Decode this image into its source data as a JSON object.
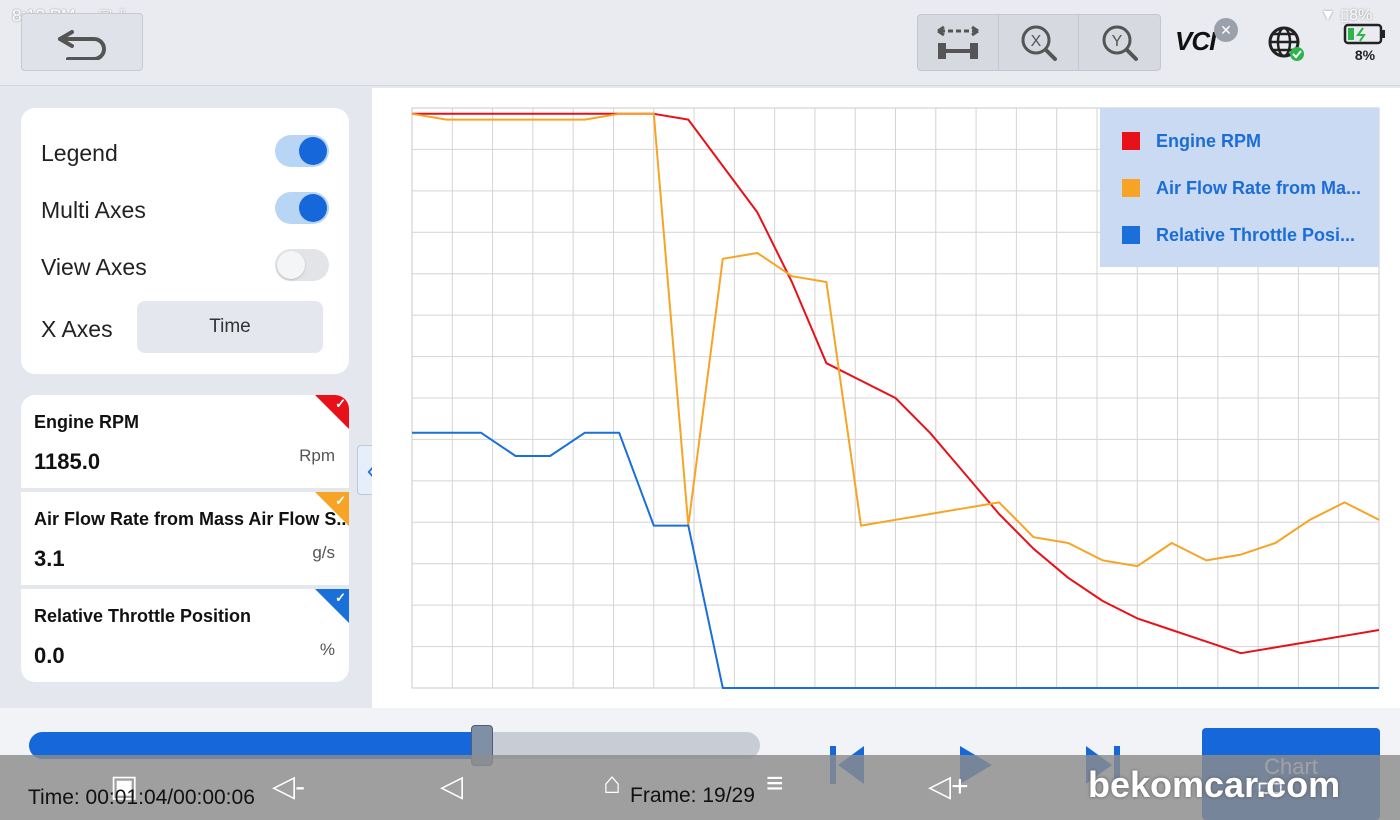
{
  "status_bar": {
    "time": "8:19 PM",
    "battery": "8%"
  },
  "topbar": {
    "back_icon": "undo-arrow-icon",
    "tools": [
      {
        "name": "fit-x-width-icon"
      },
      {
        "name": "zoom-x-icon",
        "glyph": "X"
      },
      {
        "name": "zoom-y-icon",
        "glyph": "Y"
      }
    ],
    "vci_label": "VCI",
    "battery_pct": "8%"
  },
  "settings": {
    "legend_label": "Legend",
    "legend_on": true,
    "multi_axes_label": "Multi Axes",
    "multi_axes_on": true,
    "view_axes_label": "View Axes",
    "view_axes_on": false,
    "x_axes_label": "X Axes",
    "x_axes_value": "Time"
  },
  "sensors": [
    {
      "name": "Engine RPM",
      "value": "1185.0",
      "unit": "Rpm",
      "color": "#e8111a"
    },
    {
      "name": "Air Flow Rate from Mass Air Flow S...",
      "value": "3.1",
      "unit": "g/s",
      "color": "#f7a426"
    },
    {
      "name": "Relative Throttle Position",
      "value": "0.0",
      "unit": "%",
      "color": "#1a6fd8"
    }
  ],
  "legend": [
    {
      "label": "Engine RPM",
      "color": "#e8111a"
    },
    {
      "label": "Air Flow Rate from Ma...",
      "color": "#f7a426"
    },
    {
      "label": "Relative Throttle Posi...",
      "color": "#1a6fd8"
    }
  ],
  "chart_data": {
    "type": "line",
    "grid": true,
    "legend_position": "top-right",
    "x": [
      0,
      1,
      2,
      3,
      4,
      5,
      6,
      7,
      8,
      9,
      10,
      11,
      12,
      13,
      14,
      15,
      16,
      17,
      18,
      19,
      20,
      21,
      22,
      23,
      24,
      25,
      26,
      27,
      28
    ],
    "series": [
      {
        "name": "Engine RPM",
        "color": "#e8111a",
        "values": [
          0.99,
          0.99,
          0.99,
          0.99,
          0.99,
          0.99,
          0.99,
          0.99,
          0.98,
          0.9,
          0.82,
          0.7,
          0.56,
          0.53,
          0.5,
          0.44,
          0.37,
          0.3,
          0.24,
          0.19,
          0.15,
          0.12,
          0.1,
          0.08,
          0.06,
          0.07,
          0.08,
          0.09,
          0.1
        ]
      },
      {
        "name": "Air Flow Rate from Mass Air Flow Sensor",
        "color": "#f7a426",
        "values": [
          0.99,
          0.98,
          0.98,
          0.98,
          0.98,
          0.98,
          0.99,
          0.99,
          0.28,
          0.74,
          0.75,
          0.71,
          0.7,
          0.28,
          0.29,
          0.3,
          0.31,
          0.32,
          0.26,
          0.25,
          0.22,
          0.21,
          0.25,
          0.22,
          0.23,
          0.25,
          0.29,
          0.32,
          0.29
        ]
      },
      {
        "name": "Relative Throttle Position",
        "color": "#1a6fd8",
        "values": [
          0.44,
          0.44,
          0.44,
          0.4,
          0.4,
          0.44,
          0.44,
          0.28,
          0.28,
          0.0,
          0.0,
          0.0,
          0.0,
          0.0,
          0.0,
          0.0,
          0.0,
          0.0,
          0.0,
          0.0,
          0.0,
          0.0,
          0.0,
          0.0,
          0.0,
          0.0,
          0.0,
          0.0,
          0.0
        ]
      }
    ]
  },
  "player": {
    "progress": 0.62,
    "time": "Time: 00:01:04/00:00:06",
    "frame": "Frame: 19/29",
    "chart_button": "Chart"
  },
  "watermark": "bekomcar.com"
}
